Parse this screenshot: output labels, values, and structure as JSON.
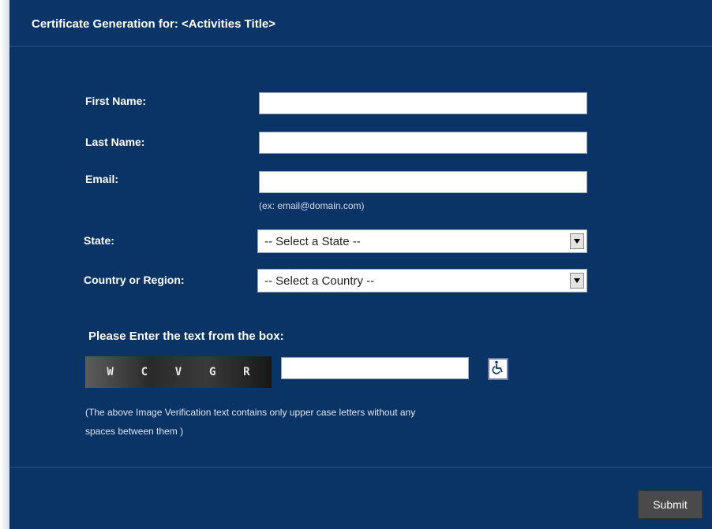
{
  "header": {
    "title": "Certificate Generation for: <Activities Title>"
  },
  "form": {
    "first_name": {
      "label": "First Name:",
      "value": ""
    },
    "last_name": {
      "label": "Last Name:",
      "value": ""
    },
    "email": {
      "label": "Email:",
      "value": "",
      "hint": "(ex: email@domain.com)"
    },
    "state": {
      "label": "State:",
      "selected": "-- Select a State --"
    },
    "country": {
      "label": "Country or Region:",
      "selected": "-- Select a Country --"
    }
  },
  "captcha": {
    "prompt": "Please Enter the text from the box:",
    "letters": [
      "W",
      "C",
      "V",
      "G",
      "R"
    ],
    "input_value": "",
    "note_line1": "(The above Image Verification text contains only upper case letters without any",
    "note_line2": "spaces between them )",
    "access_icon": "wheelchair-icon"
  },
  "actions": {
    "submit_label": "Submit"
  },
  "colors": {
    "panel": "#0a3366",
    "submit": "#4a4a4a"
  }
}
